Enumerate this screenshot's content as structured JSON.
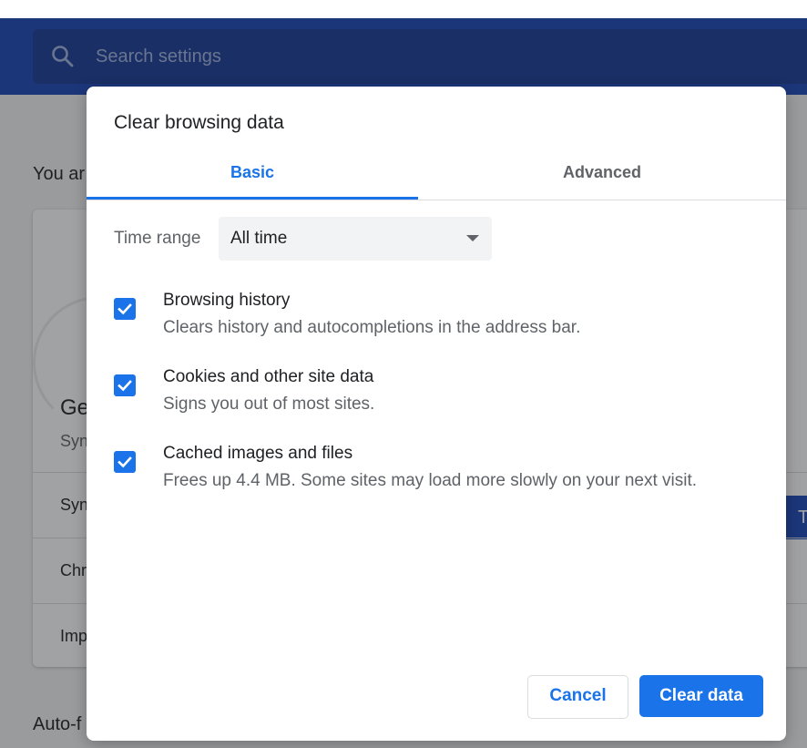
{
  "search": {
    "placeholder": "Search settings"
  },
  "background": {
    "heading_partial": "You ar",
    "card_title_partial": "Ge",
    "card_sub_partial": "Syn",
    "rows": [
      "Syn",
      "Chr",
      "Imp"
    ],
    "side_button_partial": "T",
    "footer_partial": "Auto-f"
  },
  "dialog": {
    "title": "Clear browsing data",
    "tabs": [
      {
        "label": "Basic",
        "selected": true
      },
      {
        "label": "Advanced",
        "selected": false
      }
    ],
    "time_range": {
      "label": "Time range",
      "value": "All time"
    },
    "options": [
      {
        "title": "Browsing history",
        "description": "Clears history and autocompletions in the address bar.",
        "checked": true
      },
      {
        "title": "Cookies and other site data",
        "description": "Signs you out of most sites.",
        "checked": true
      },
      {
        "title": "Cached images and files",
        "description": "Frees up 4.4 MB. Some sites may load more slowly on your next visit.",
        "checked": true
      }
    ],
    "buttons": {
      "cancel": "Cancel",
      "confirm": "Clear data"
    }
  },
  "colors": {
    "accent": "#1a73e8",
    "toolbar": "#1a46b8",
    "text_primary": "#202124",
    "text_secondary": "#5f6368"
  }
}
